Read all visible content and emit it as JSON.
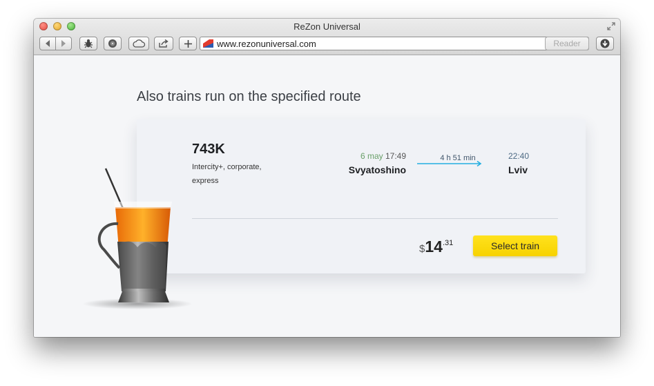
{
  "window": {
    "title": "ReZon Universal",
    "url": "www.rezonuniversal.com",
    "reader_label": "Reader",
    "toolbar_icons": [
      "back-icon",
      "forward-icon",
      "bug-icon",
      "disc-icon",
      "cloud-icon",
      "share-icon",
      "plus-icon",
      "reload-icon",
      "download-icon"
    ]
  },
  "page": {
    "section_title": "Also trains run on the specified route"
  },
  "train": {
    "number": "743K",
    "type_line1": "Intercity+, corporate,",
    "type_line2": "express",
    "departure": {
      "date": "6 may",
      "time": "17:49",
      "station": "Svyatoshino"
    },
    "duration": "4 h 51 min",
    "arrival": {
      "time": "22:40",
      "station": "Lviv"
    },
    "price": {
      "currency": "$",
      "main": "14",
      "cents": ".31"
    },
    "select_label": "Select train"
  },
  "colors": {
    "button_yellow": "#ffe21e",
    "arrow_blue": "#23aee0",
    "departure_date_green": "#6aa06a"
  }
}
